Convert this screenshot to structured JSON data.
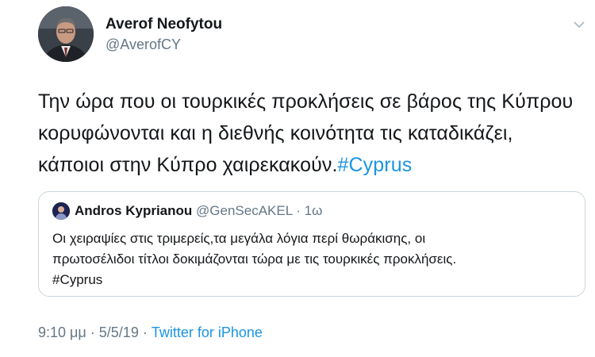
{
  "author": {
    "name": "Averof Neofytou",
    "handle": "@AverofCY",
    "avatar_icon": "profile-photo"
  },
  "tweet": {
    "line1": "Την ώρα που οι τουρκικές προκλήσεις σε βάρος της Κύπρου",
    "line2": "κορυφώνονται και η διεθνής κοινότητα τις καταδικάζει,",
    "line3_text": "κάποιοι στην Κύπρο χαιρεκακούν.",
    "hashtag": "#Cyprus"
  },
  "quoted_tweet": {
    "name": "Andros Kyprianou",
    "handle": "@GenSecAKEL",
    "time": "1ω",
    "line1": "Οι χειραψίες στις τριμερείς,τα μεγάλα λόγια περί θωράκισης, οι",
    "line2": "πρωτοσέλιδοι τίτλοι δοκιμάζονται τώρα με τις τουρκικές προκλήσεις.",
    "line3": "#Cyprus"
  },
  "footer": {
    "time": "9:10 μμ",
    "date": "5/5/19",
    "source": "Twitter for iPhone"
  },
  "colors": {
    "text": "#14171a",
    "secondary": "#657786",
    "link": "#1b95e0",
    "border": "#ccd6dd"
  }
}
